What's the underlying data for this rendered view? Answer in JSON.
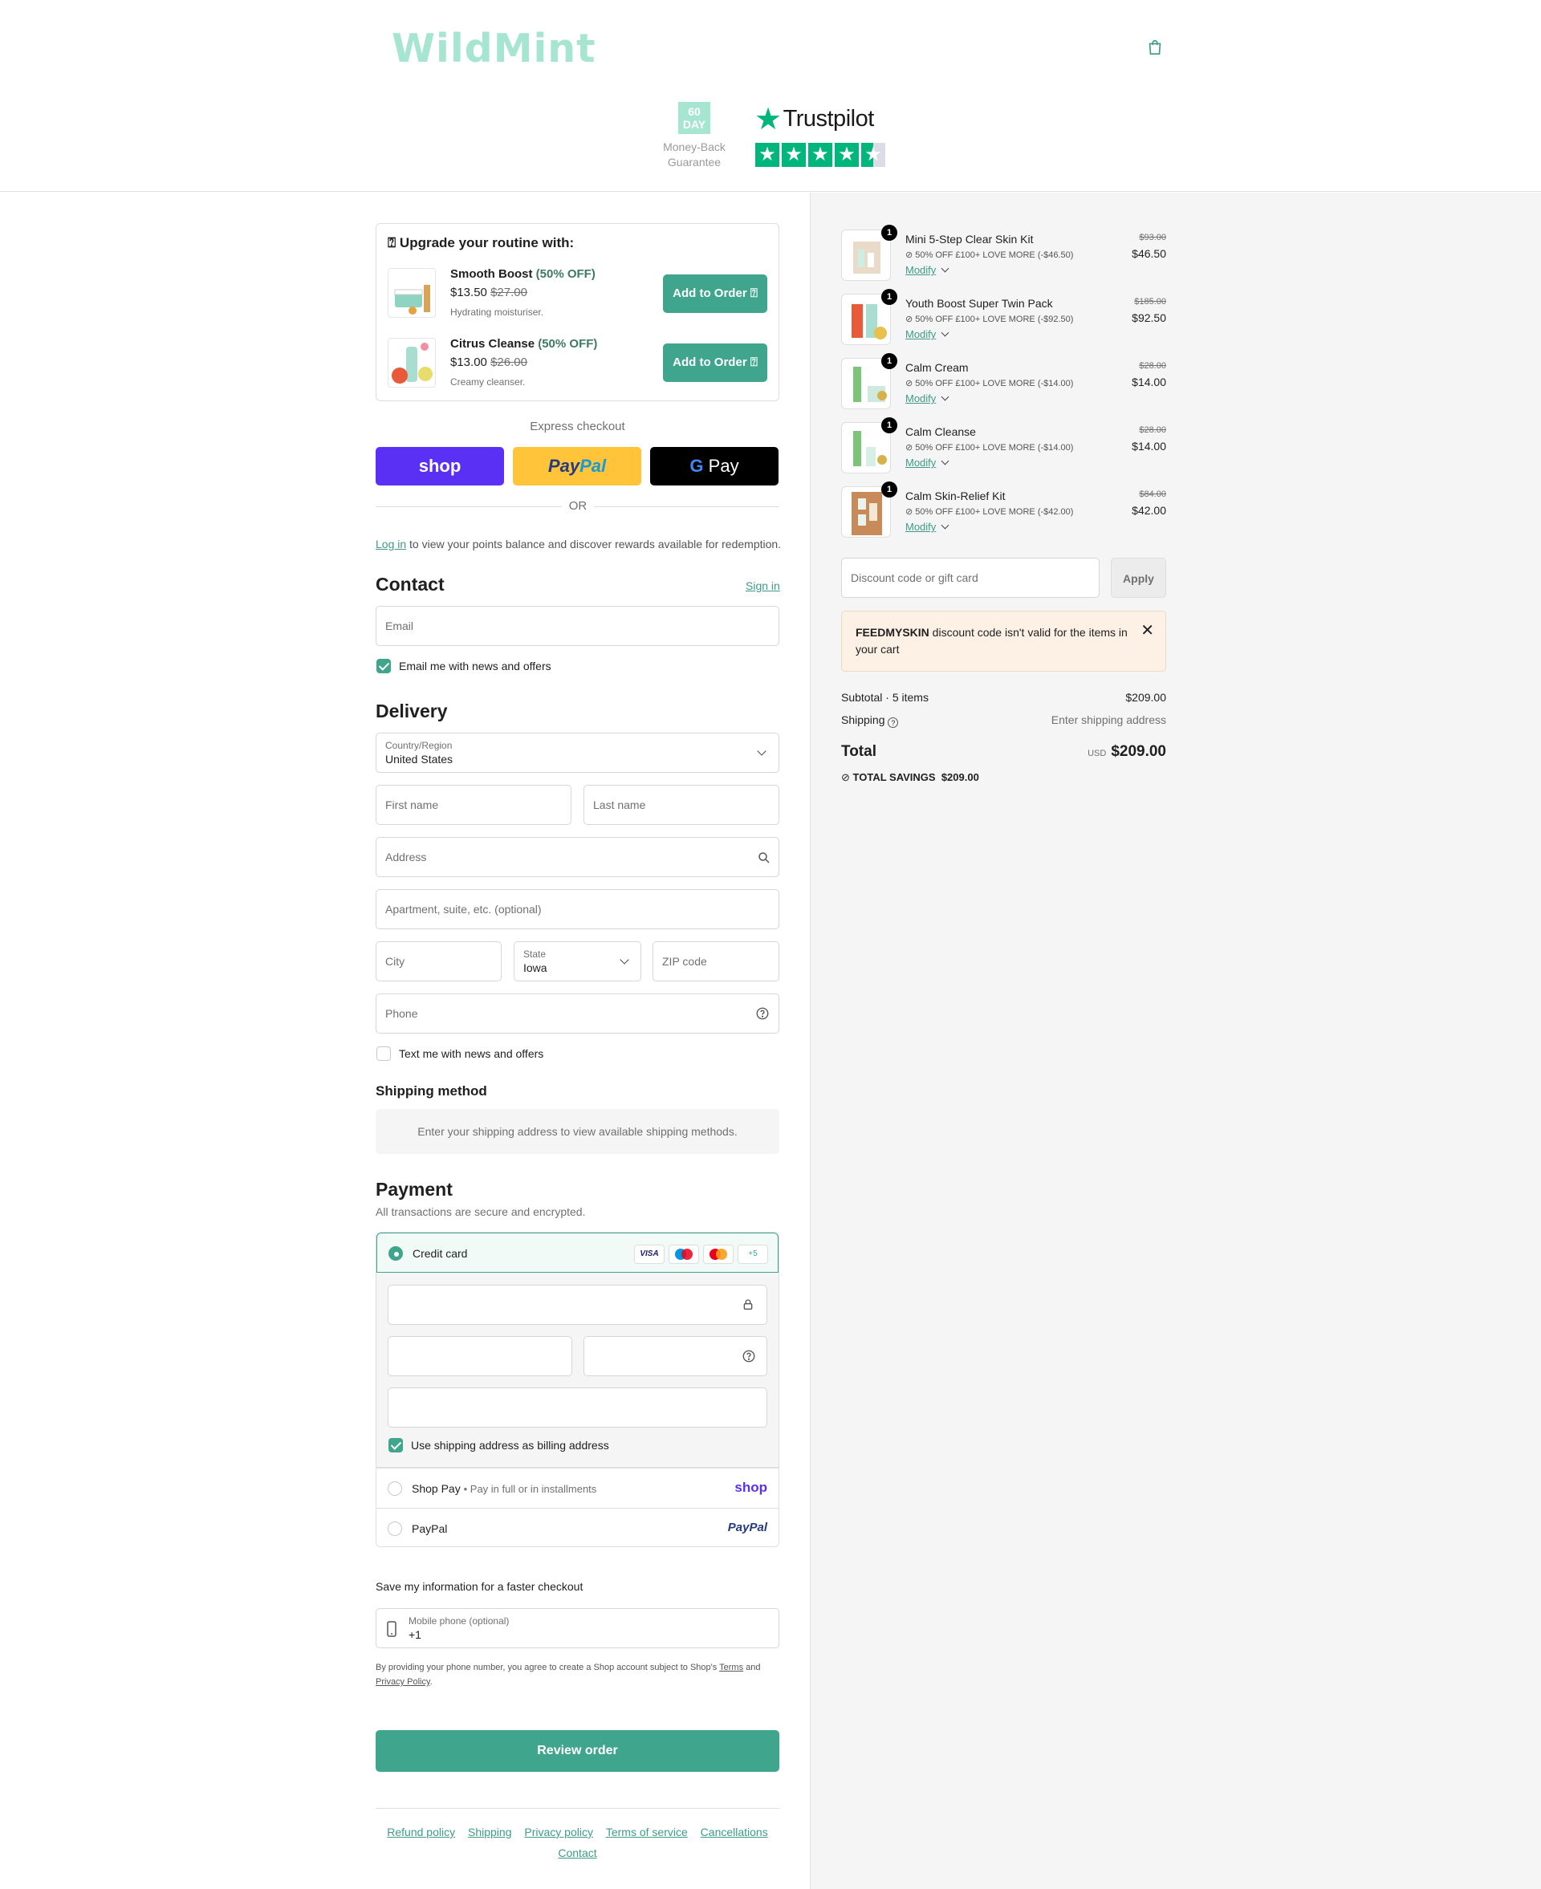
{
  "brand": {
    "logo": "WildMint",
    "accent": "#3fa58d",
    "logo_color": "#a6e5cf"
  },
  "header": {
    "cart_icon": "shopping-bag-icon",
    "guarantee_days": "60",
    "guarantee_unit": "DAY",
    "guarantee_text": "Money-Back Guarantee",
    "trustpilot_label": "Trustpilot",
    "trustpilot_rating": 4.5
  },
  "upsell": {
    "title": "⍰ Upgrade your routine with:",
    "items": [
      {
        "name": "Smooth Boost",
        "discount": "(50% OFF)",
        "price": "$13.50",
        "old_price": "$27.00",
        "desc": "Hydrating moisturiser.",
        "button": "Add to Order ⍰"
      },
      {
        "name": "Citrus Cleanse",
        "discount": "(50% OFF)",
        "price": "$13.00",
        "old_price": "$26.00",
        "desc": "Creamy cleanser.",
        "button": "Add to Order ⍰"
      }
    ]
  },
  "express": {
    "label": "Express checkout",
    "shop_pay": "shop",
    "paypal_a": "Pay",
    "paypal_b": "Pal",
    "gpay": "Pay",
    "or": "OR"
  },
  "login": {
    "link": "Log in",
    "text": " to view your points balance and discover rewards available for redemption."
  },
  "contact": {
    "title": "Contact",
    "sign_in": "Sign in",
    "email_placeholder": "Email",
    "news_label": "Email me with news and offers",
    "news_checked": true
  },
  "delivery": {
    "title": "Delivery",
    "country_label": "Country/Region",
    "country": "United States",
    "first_name": "First name",
    "last_name": "Last name",
    "address": "Address",
    "apartment": "Apartment, suite, etc. (optional)",
    "city": "City",
    "state_label": "State",
    "state": "Iowa",
    "zip": "ZIP code",
    "phone": "Phone",
    "text_label": "Text me with news and offers",
    "text_checked": false
  },
  "shipping": {
    "title": "Shipping method",
    "message": "Enter your shipping address to view available shipping methods."
  },
  "payment": {
    "title": "Payment",
    "subtitle": "All transactions are secure and encrypted.",
    "credit_card": "Credit card",
    "cards": [
      "VISA",
      "Maestro",
      "Mastercard",
      "+5"
    ],
    "billing_label": "Use shipping address as billing address",
    "shop_pay": "Shop Pay",
    "shop_pay_sub": "Pay in full or in installments",
    "shop_pay_logo": "shop",
    "paypal": "PayPal",
    "paypal_logo": "PayPal"
  },
  "save": {
    "title": "Save my information for a faster checkout",
    "phone_label": "Mobile phone (optional)",
    "phone_value": "+1",
    "terms_pre": "By providing your phone number, you agree to create a Shop account subject to Shop's ",
    "terms_link": "Terms",
    "terms_and": " and ",
    "privacy_link": "Privacy Policy",
    "terms_end": "."
  },
  "review_button": "Review order",
  "footer": {
    "links": [
      "Refund policy",
      "Shipping",
      "Privacy policy",
      "Terms of service",
      "Cancellations",
      "Contact"
    ]
  },
  "order": {
    "items": [
      {
        "qty": "1",
        "name": "Mini 5-Step Clear Skin Kit",
        "discount": "50% OFF £100+ LOVE MORE (-$46.50)",
        "modify": "Modify",
        "old": "$93.00",
        "price": "$46.50"
      },
      {
        "qty": "1",
        "name": "Youth Boost Super Twin Pack",
        "discount": "50% OFF £100+ LOVE MORE (-$92.50)",
        "modify": "Modify",
        "old": "$185.00",
        "price": "$92.50"
      },
      {
        "qty": "1",
        "name": "Calm Cream",
        "discount": "50% OFF £100+ LOVE MORE (-$14.00)",
        "modify": "Modify",
        "old": "$28.00",
        "price": "$14.00"
      },
      {
        "qty": "1",
        "name": "Calm Cleanse",
        "discount": "50% OFF £100+ LOVE MORE (-$14.00)",
        "modify": "Modify",
        "old": "$28.00",
        "price": "$14.00"
      },
      {
        "qty": "1",
        "name": "Calm Skin-Relief Kit",
        "discount": "50% OFF £100+ LOVE MORE (-$42.00)",
        "modify": "Modify",
        "old": "$84.00",
        "price": "$42.00"
      }
    ],
    "discount_placeholder": "Discount code or gift card",
    "apply": "Apply",
    "notice_code": "FEEDMYSKIN",
    "notice_text": " discount code isn't valid for the items in your cart",
    "subtotal_label": "Subtotal · 5 items",
    "subtotal": "$209.00",
    "shipping_label": "Shipping",
    "shipping_value": "Enter shipping address",
    "total_label": "Total",
    "currency": "USD",
    "total": "$209.00",
    "savings_label": "TOTAL SAVINGS",
    "savings": "$209.00"
  }
}
